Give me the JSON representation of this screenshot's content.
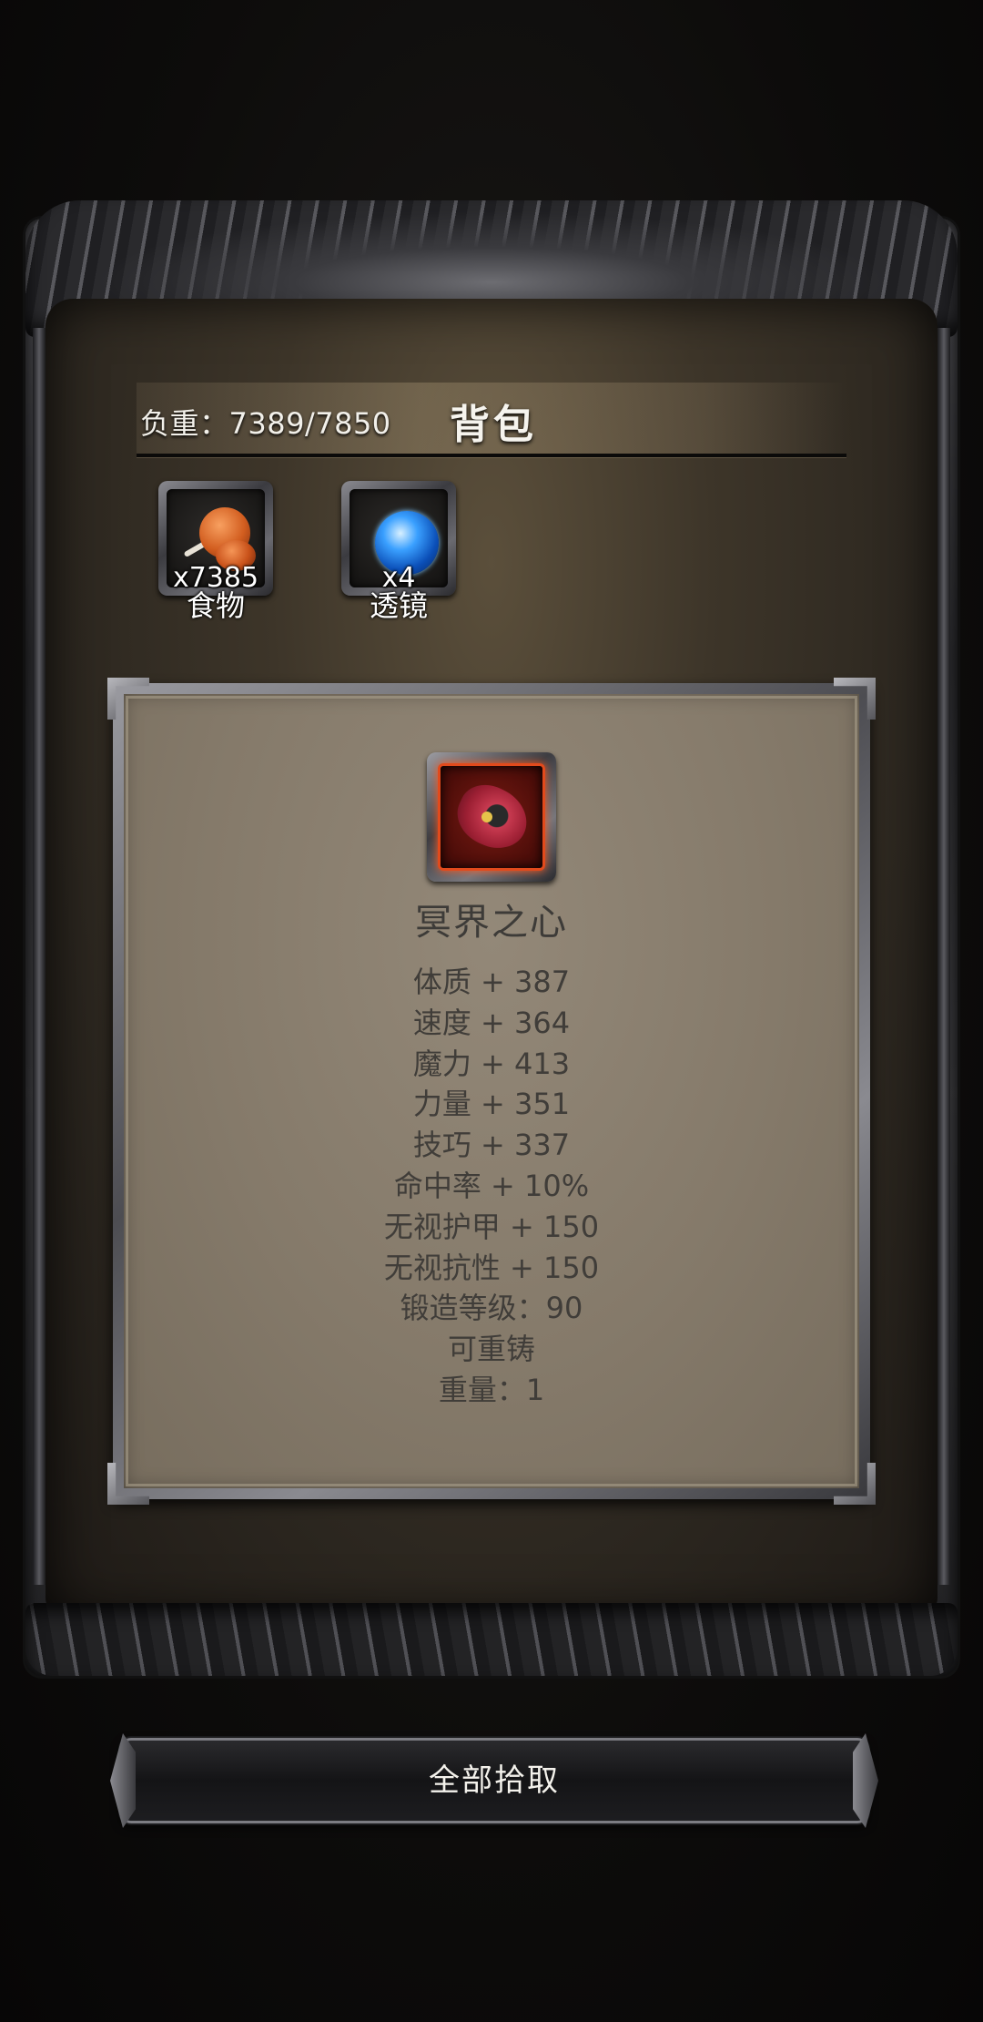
{
  "header": {
    "weight_label": "负重：7389/7850",
    "title": "背包"
  },
  "inventory": [
    {
      "name": "食物",
      "count": "x7385",
      "icon": "roast-meat-icon"
    },
    {
      "name": "透镜",
      "count": "x4",
      "icon": "blue-lens-icon"
    }
  ],
  "detail": {
    "icon": "heart-of-underworld-icon",
    "name": "冥界之心",
    "stats": [
      "体质 + 387",
      "速度 + 364",
      "魔力 + 413",
      "力量 + 351",
      "技巧 + 337",
      "命中率 + 10%",
      "无视护甲 + 150",
      "无视抗性 + 150",
      "锻造等级：90",
      "可重铸",
      "重量：1"
    ]
  },
  "actions": {
    "pickup_all": "全部拾取"
  },
  "colors": {
    "rarity_border": "#e24a1c",
    "panel_bg": "#857a6a",
    "stat_text": "#403d39"
  }
}
